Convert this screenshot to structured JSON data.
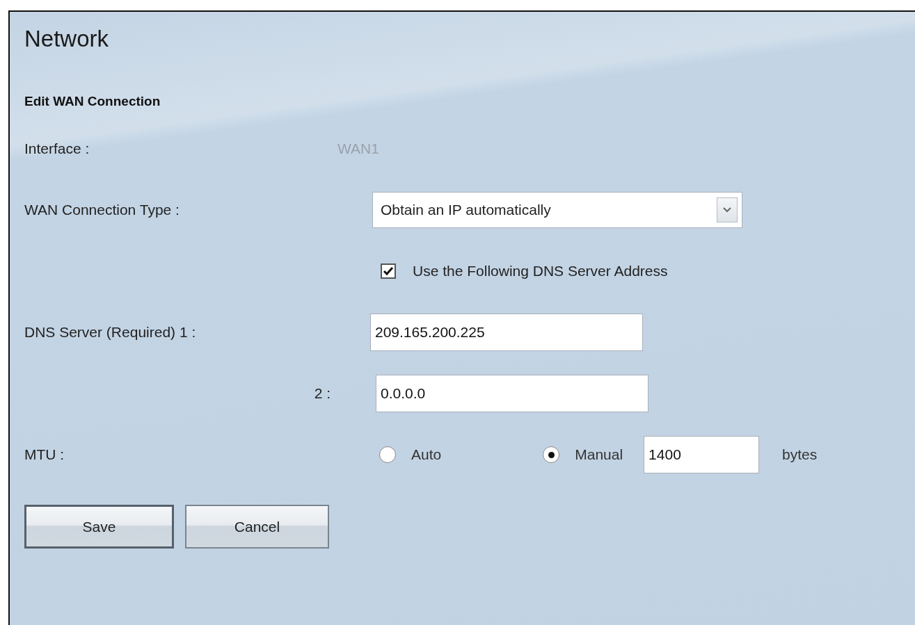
{
  "title": "Network",
  "subtitle": "Edit WAN Connection",
  "fields": [
    {
      "kind": "text",
      "label": "Interface :",
      "value": "WAN1"
    },
    {
      "kind": "select",
      "label": "WAN Connection Type :",
      "value": "Obtain an IP automatically"
    },
    {
      "kind": "checkbox",
      "text": "Use the Following DNS Server Address",
      "checked": true
    },
    {
      "kind": "input",
      "label": "DNS Server (Required) 1 :",
      "value": "209.165.200.225"
    },
    {
      "kind": "subinput",
      "label": "2 :",
      "value": "0.0.0.0"
    },
    {
      "kind": "radio",
      "label": "MTU :",
      "options": [
        {
          "label": "Auto",
          "selected": false
        },
        {
          "label": "Manual",
          "selected": true
        }
      ],
      "value": "1400",
      "unit": "bytes"
    }
  ],
  "buttons": [
    {
      "label": "Save",
      "focused": true
    },
    {
      "label": "Cancel",
      "focused": false
    }
  ]
}
